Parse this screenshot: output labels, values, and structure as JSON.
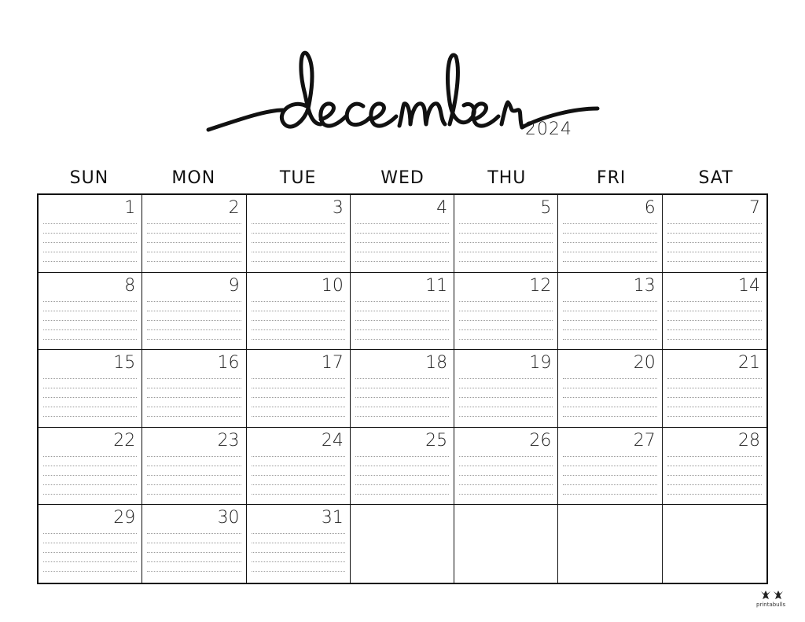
{
  "header": {
    "month": "december",
    "year": "2024"
  },
  "weekdays": [
    "SUN",
    "MON",
    "TUE",
    "WED",
    "THU",
    "FRI",
    "SAT"
  ],
  "weeks": [
    [
      "1",
      "2",
      "3",
      "4",
      "5",
      "6",
      "7"
    ],
    [
      "8",
      "9",
      "10",
      "11",
      "12",
      "13",
      "14"
    ],
    [
      "15",
      "16",
      "17",
      "18",
      "19",
      "20",
      "21"
    ],
    [
      "22",
      "23",
      "24",
      "25",
      "26",
      "27",
      "28"
    ],
    [
      "29",
      "30",
      "31",
      "",
      "",
      "",
      ""
    ]
  ],
  "footer": {
    "brand": "printabulls"
  }
}
